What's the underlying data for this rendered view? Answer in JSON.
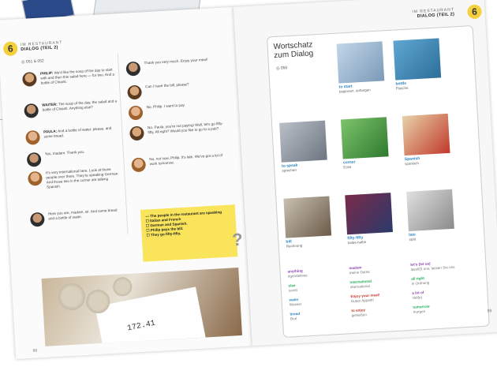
{
  "left_page": {
    "badge": "6",
    "header_top": "IM RESTAURANT",
    "header_bottom": "DIALOG (TEIL 2)",
    "audio": "051 & 052",
    "dialog_col1": [
      {
        "speaker": "PHILIP:",
        "text": "We'd like the soup of the day to start with and then this salad here — for two. And a bottle of Chianti.",
        "avatar": "p"
      },
      {
        "speaker": "WAITER:",
        "text": "The soup of the day, the salad and a bottle of Chianti. Anything else?",
        "avatar": "w"
      },
      {
        "speaker": "PAULA:",
        "text": "And a bottle of water, please, and some bread.",
        "avatar": "l"
      },
      {
        "speaker": "",
        "text": "Yes, madam. Thank you.",
        "avatar": "w"
      },
      {
        "speaker": "",
        "text": "It's very international here. Look at those people over there. They're speaking German. And those two in the corner are talking Spanish.",
        "avatar": "l"
      },
      {
        "speaker": "",
        "text": "Here you are, madam, sir. And some bread and a bottle of water.",
        "avatar": "w"
      }
    ],
    "dialog_col2": [
      {
        "text": "Thank you very much. Enjoy your meal!",
        "avatar": "w"
      },
      {
        "text": "Can I have the bill, please?",
        "avatar": "p"
      },
      {
        "text": "No, Philip. I want to pay.",
        "avatar": "l"
      },
      {
        "text": "No, Paula, you're not paying! Well, let's go fifty-fifty. All right? Would you like to go to a pub?",
        "avatar": "p"
      },
      {
        "text": "No, not now, Philip. It's late. We've got a lot of work tomorrow.",
        "avatar": "l"
      }
    ],
    "quiz": [
      "— The people in the restaurant are speaking",
      "☐ Italian and French",
      "☐ German and Spanish.",
      "☐ Philip pays the bill.",
      "☐ They go fifty-fifty."
    ],
    "receipt_amount": "172.41",
    "page_number": "88"
  },
  "right_page": {
    "badge": "6",
    "header_top": "IM RESTAURANT",
    "header_bottom": "DIALOG (TEIL 2)",
    "vocab_title_1": "Wortschatz",
    "vocab_title_2": "zum Dialog",
    "audio": "050",
    "tiles": [
      {
        "en": "to start",
        "de": "beginnen, anfangen"
      },
      {
        "en": "bottle",
        "de": "Flasche"
      },
      {
        "en": "to speak",
        "de": "sprechen"
      },
      {
        "en": "corner",
        "de": "Ecke"
      },
      {
        "en": "Spanish",
        "de": "spanisch"
      },
      {
        "en": "bill",
        "de": "Rechnung"
      },
      {
        "en": "fifty-fifty",
        "de": "halbe-halbe"
      },
      {
        "en": "late",
        "de": "spät"
      }
    ],
    "vocab": [
      {
        "en": "anything",
        "de": "irgendetwas"
      },
      {
        "en": "madam",
        "de": "meine Dame"
      },
      {
        "en": "let's (let us)",
        "de": "lasst/(l) uns, lassen Sie uns"
      },
      {
        "en": "else",
        "de": "sonst"
      },
      {
        "en": "international",
        "de": "international"
      },
      {
        "en": "all right",
        "de": "in Ordnung"
      },
      {
        "en": "water",
        "de": "Wasser"
      },
      {
        "en": "Enjoy your meal!",
        "de": "Guten Appetit!"
      },
      {
        "en": "a lot of",
        "de": "viel(e)"
      },
      {
        "en": "bread",
        "de": "Brot"
      },
      {
        "en": "to enjoy",
        "de": "genießen"
      },
      {
        "en": "tomorrow",
        "de": "morgen"
      }
    ],
    "page_number": "89"
  }
}
